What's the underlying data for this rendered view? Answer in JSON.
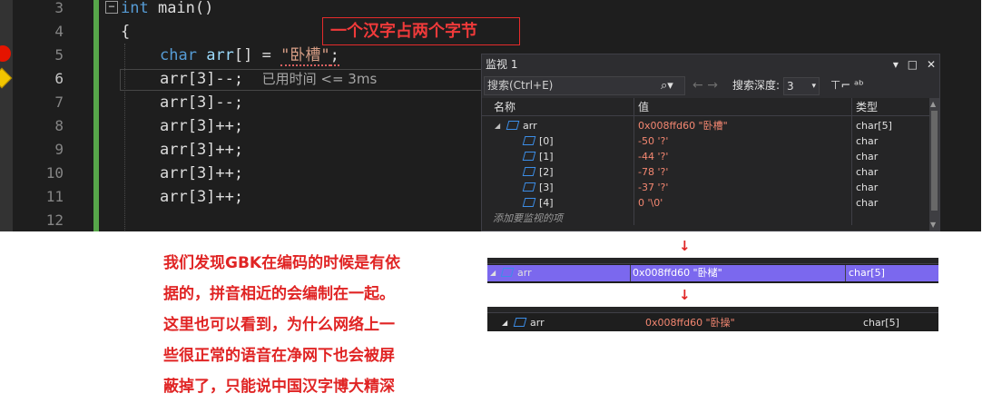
{
  "editor": {
    "line_numbers": [
      "3",
      "4",
      "5",
      "6",
      "7",
      "8",
      "9",
      "10",
      "11",
      "12"
    ],
    "lines": [
      {
        "kw": "int",
        "rest": " main()"
      },
      {
        "text": "{"
      },
      {
        "kw": "char",
        "var": "arr",
        "punct": "[] = ",
        "str": "\"卧槽\"",
        "end": ";"
      },
      {
        "code": "arr[3]--;",
        "hint": "已用时间 <= 3ms"
      },
      {
        "code": "arr[3]--;"
      },
      {
        "code": "arr[3]++;"
      },
      {
        "code": "arr[3]++;"
      },
      {
        "code": "arr[3]++;"
      },
      {
        "code": "arr[3]++;"
      }
    ],
    "collapse_glyph": "−",
    "annotation": "一个汉字占两个字节"
  },
  "watch": {
    "title": "监视 1",
    "title_icons": {
      "dropdown": "▾",
      "maximize": "□",
      "close": "✕"
    },
    "search_placeholder": "搜索(Ctrl+E)",
    "search_icon": "⌕▾",
    "nav": {
      "back": "←",
      "forward": "→"
    },
    "depth_label": "搜索深度:",
    "depth_value": "3",
    "depth_arrow": "▾",
    "toolbar_icons": {
      "pin": "⊤⌐",
      "format": "ᵃᵇ"
    },
    "columns": {
      "name": "名称",
      "value": "值",
      "type": "类型"
    },
    "rows": [
      {
        "expander": "◢",
        "name": "arr",
        "value": "0x008ffd60 \"卧槽\"",
        "type": "char[5]"
      },
      {
        "name": "[0]",
        "value": "-50 '?'",
        "type": "char"
      },
      {
        "name": "[1]",
        "value": "-44 '?'",
        "type": "char"
      },
      {
        "name": "[2]",
        "value": "-78 '?'",
        "type": "char"
      },
      {
        "name": "[3]",
        "value": "-37 '?'",
        "type": "char"
      },
      {
        "name": "[4]",
        "value": "0 '\\0'",
        "type": "char"
      }
    ],
    "add_item": "添加要监视的项"
  },
  "explanation": [
    "我们发现GBK在编码的时候是有依",
    "据的，拼音相近的会编制在一起。",
    "这里也可以看到，为什么网络上一",
    "些很正常的语音在净网下也会被屏",
    "蔽掉了，只能说中国汉字博大精深"
  ],
  "arrow_glyph": "↓",
  "strip1": {
    "expander": "◢",
    "name": "arr",
    "value": "0x008ffd60 \"卧槠\"",
    "type": "char[5]"
  },
  "strip2": {
    "expander": "◢",
    "name": "arr",
    "value": "0x008ffd60 \"卧操\"",
    "type": "char[5]"
  },
  "colors": {
    "editor_bg": "#1e1e1e",
    "keyword": "#569cd6",
    "string": "#d69d85",
    "annotation_red": "#e02424",
    "selection": "#7b68ee"
  }
}
